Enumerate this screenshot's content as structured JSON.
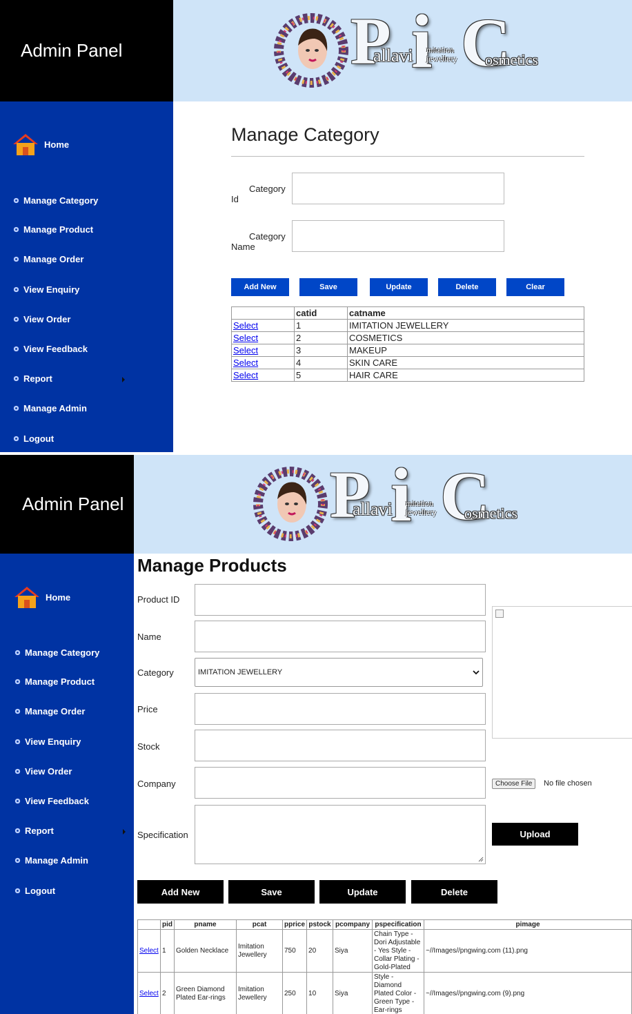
{
  "colors": {
    "sidebar": "#0033a3",
    "brand_bg": "#000000",
    "banner": "#cfe4f8",
    "button_blue": "#0046c7",
    "button_black": "#000000"
  },
  "logo": {
    "letter_p": "P",
    "word_p": "allavi",
    "letter_i": "i",
    "word_i": "mitation jewellery",
    "letter_c": "C",
    "word_c": "osmetics"
  },
  "panel1": {
    "brand": "Admin Panel",
    "nav_home": "Home",
    "nav": [
      "Manage Category",
      "Manage Product",
      "Manage Order",
      "View Enquiry",
      "View Order",
      "View Feedback",
      "Report",
      "Manage Admin",
      "Logout"
    ],
    "title": "Manage Category",
    "fields": {
      "id_label_line1": "Category",
      "id_label_line2": "Id",
      "name_label_line1": "Category",
      "name_label_line2": "Name"
    },
    "buttons": [
      "Add New",
      "Save",
      "Update",
      "Delete",
      "Clear"
    ],
    "table": {
      "headers": [
        "",
        "catid",
        "catname"
      ],
      "select_label": "Select",
      "rows": [
        {
          "catid": "1",
          "catname": "IMITATION JEWELLERY"
        },
        {
          "catid": "2",
          "catname": "COSMETICS"
        },
        {
          "catid": "3",
          "catname": "MAKEUP"
        },
        {
          "catid": "4",
          "catname": "SKIN CARE"
        },
        {
          "catid": "5",
          "catname": "HAIR CARE"
        }
      ]
    }
  },
  "panel2": {
    "brand": "Admin Panel",
    "nav_home": "Home",
    "nav": [
      "Manage Category",
      "Manage Product",
      "Manage Order",
      "View Enquiry",
      "View Order",
      "View Feedback",
      "Report",
      "Manage Admin",
      "Logout"
    ],
    "title": "Manage Products",
    "labels": [
      "Product ID",
      "Name",
      "Category",
      "Price",
      "Stock",
      "Company",
      "Specification"
    ],
    "category_selected": "IMITATION JEWELLERY",
    "file": {
      "button": "Choose File",
      "status": "No file chosen"
    },
    "upload": "Upload",
    "buttons": [
      "Add New",
      "Save",
      "Update",
      "Delete"
    ],
    "table": {
      "headers": [
        "",
        "pid",
        "pname",
        "pcat",
        "pprice",
        "pstock",
        "pcompany",
        "pspecification",
        "pimage"
      ],
      "select_label": "Select",
      "rows": [
        {
          "pid": "1",
          "pname": "Golden Necklace",
          "pcat": "Imitation Jewellery",
          "pprice": "750",
          "pstock": "20",
          "pcompany": "Siya",
          "pspecification": "Chain Type - Dori Adjustable - Yes Style - Collar Plating - Gold-Plated",
          "pimage": "~//Images//pngwing.com (11).png"
        },
        {
          "pid": "2",
          "pname": "Green Diamond Plated Ear-rings",
          "pcat": "Imitation Jewellery",
          "pprice": "250",
          "pstock": "10",
          "pcompany": "Siya",
          "pspecification": "Style - Diamond Plated Color - Green Type - Ear-rings",
          "pimage": "~//Images//pngwing.com (9).png"
        }
      ]
    }
  }
}
